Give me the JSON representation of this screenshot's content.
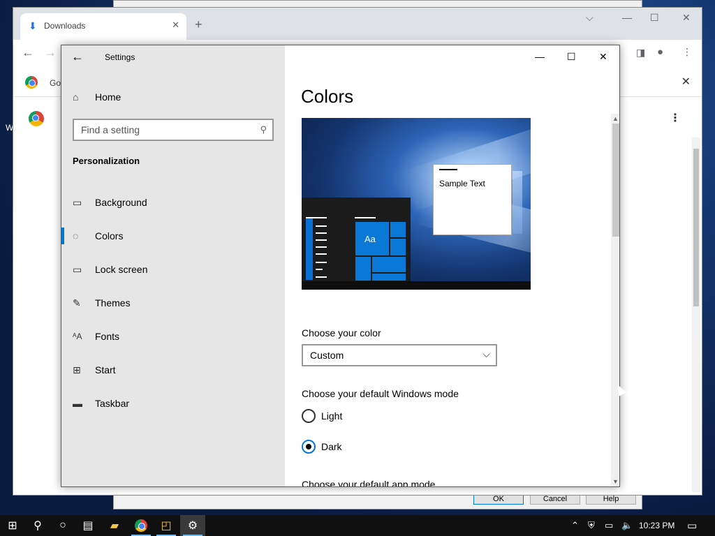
{
  "desktop": {
    "label": "W"
  },
  "background_dialog": {
    "ok": "OK",
    "cancel": "Cancel",
    "help": "Help"
  },
  "chrome": {
    "tab_title": "Downloads",
    "bookmark_label": "Go"
  },
  "settings": {
    "window_title": "Settings",
    "home_label": "Home",
    "search_placeholder": "Find a setting",
    "section_title": "Personalization",
    "nav": [
      {
        "label": "Background",
        "icon": "image-icon"
      },
      {
        "label": "Colors",
        "icon": "palette-icon"
      },
      {
        "label": "Lock screen",
        "icon": "lock-screen-icon"
      },
      {
        "label": "Themes",
        "icon": "themes-icon"
      },
      {
        "label": "Fonts",
        "icon": "fonts-icon"
      },
      {
        "label": "Start",
        "icon": "start-icon"
      },
      {
        "label": "Taskbar",
        "icon": "taskbar-icon"
      }
    ],
    "active_nav": "Colors",
    "page_title": "Colors",
    "preview": {
      "tile_text": "Aa",
      "sample_text": "Sample Text"
    },
    "choose_color_label": "Choose your color",
    "choose_color_value": "Custom",
    "windows_mode_label": "Choose your default Windows mode",
    "windows_mode_options": [
      "Light",
      "Dark"
    ],
    "windows_mode_selected": "Dark",
    "app_mode_label": "Choose your default app mode"
  },
  "taskbar": {
    "time": "10:23 PM"
  },
  "colors": {
    "accent": "#0078d7",
    "sidebar": "#e6e6e6",
    "taskbar": "#101010"
  }
}
